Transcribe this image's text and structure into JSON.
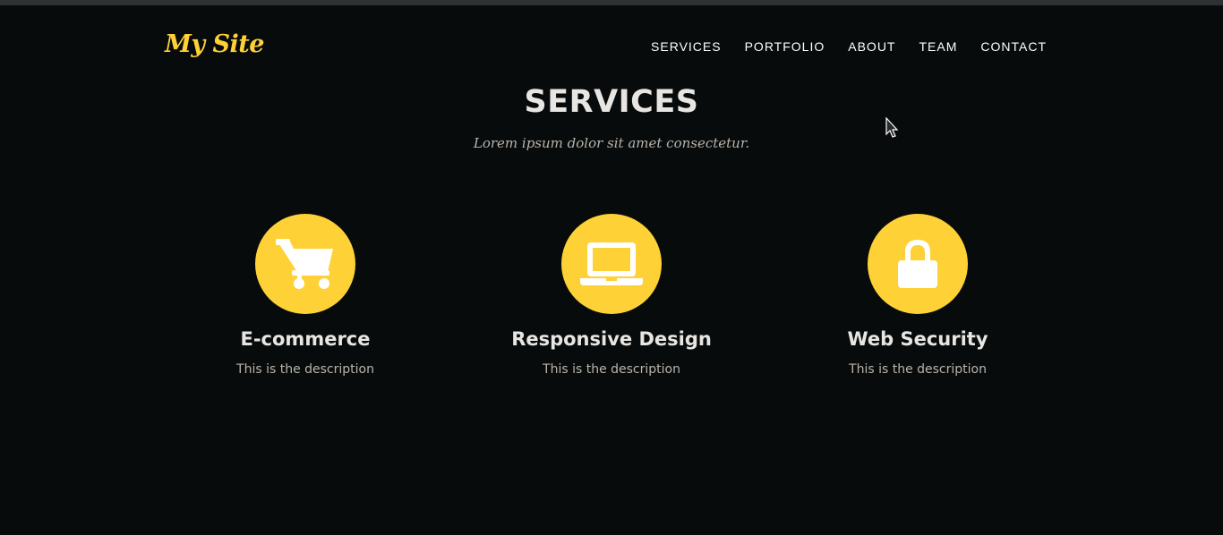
{
  "header": {
    "brand": "My Site",
    "nav": [
      "SERVICES",
      "PORTFOLIO",
      "ABOUT",
      "TEAM",
      "CONTACT"
    ]
  },
  "section": {
    "title": "SERVICES",
    "subtitle": "Lorem ipsum dolor sit amet consectetur."
  },
  "services": [
    {
      "icon": "shopping-cart-icon",
      "heading": "E-commerce",
      "description": "This is the description"
    },
    {
      "icon": "laptop-icon",
      "heading": "Responsive Design",
      "description": "This is the description"
    },
    {
      "icon": "lock-icon",
      "heading": "Web Security",
      "description": "This is the description"
    }
  ],
  "colors": {
    "accent": "#fed136",
    "background": "#080b0c"
  }
}
